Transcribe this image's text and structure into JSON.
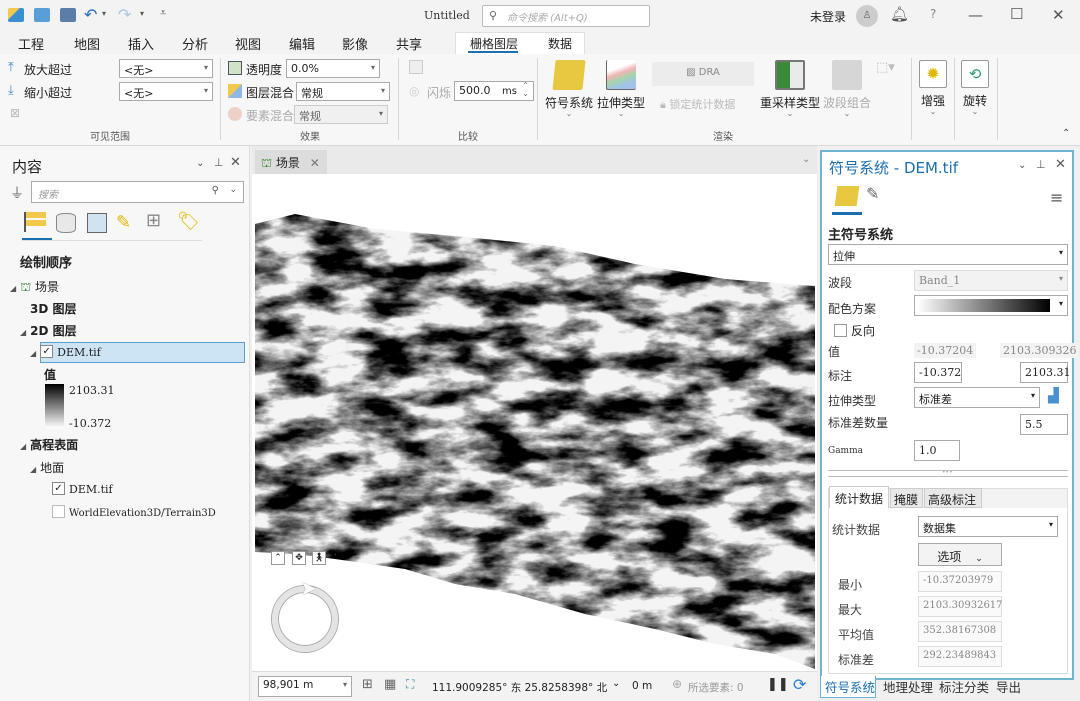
{
  "app": {
    "title": "Untitled",
    "command_search_placeholder": "命令搜索 (Alt+Q)",
    "user_status": "未登录",
    "help": "?",
    "minimize": "—",
    "maximize": "☐",
    "close": "✕"
  },
  "menu_tabs": [
    "工程",
    "地图",
    "插入",
    "分析",
    "视图",
    "编辑",
    "影像",
    "共享"
  ],
  "context_tabs": {
    "raster_layer": "栅格图层",
    "data": "数据",
    "active": "栅格图层"
  },
  "ribbon": {
    "visibility": {
      "zoom_in_beyond": "放大超过",
      "zoom_out_beyond": "缩小超过",
      "zoom_in_value": "<无>",
      "zoom_out_value": "<无>",
      "group_label": "可见范围"
    },
    "effects": {
      "transparency_label": "透明度",
      "transparency_value": "0.0%",
      "layer_blend_label": "图层混合",
      "layer_blend_value": "常规",
      "feature_blend_label": "要素混合",
      "feature_blend_value": "常规",
      "group_label": "效果"
    },
    "compare": {
      "flicker_label": "闪烁",
      "flicker_value": "500.0",
      "flicker_unit": "ms",
      "group_label": "比较"
    },
    "rendering": {
      "symbology": "符号系统",
      "stretch_type": "拉伸类型",
      "dra": "DRA",
      "lock_stats": "锁定统计数据",
      "resample_type": "重采样类型",
      "band_combo": "波段组合",
      "group_label": "渲染"
    },
    "enhance": "增强",
    "rotate": "旋转"
  },
  "contents": {
    "title": "内容",
    "search_placeholder": "搜索",
    "section_title": "绘制顺序",
    "scene": "场景",
    "layers_3d": "3D 图层",
    "layers_2d": "2D 图层",
    "dem_layer": "DEM.tif",
    "dem_checked": true,
    "legend_title": "值",
    "legend_max": "2103.31",
    "legend_min": "-10.372",
    "elevation_surfaces": "高程表面",
    "ground": "地面",
    "ground_sources": [
      {
        "name": "DEM.tif",
        "checked": true
      },
      {
        "name": "WorldElevation3D/Terrain3D",
        "checked": false
      }
    ]
  },
  "map": {
    "tab_label": "场景",
    "scale": "98,901 m",
    "coordinates": "111.9009285° 东 25.8258398° 北",
    "elevation": "0 m",
    "selected_features": "所选要素: 0"
  },
  "symbology": {
    "title": "符号系统 - DEM.tif",
    "primary_section": "主符号系统",
    "renderer": "拉伸",
    "band_label": "波段",
    "band_value": "Band_1",
    "color_scheme_label": "配色方案",
    "invert_label": "反向",
    "invert_checked": false,
    "value_label": "值",
    "value_min": "-10.37204",
    "value_max": "2103.309326",
    "label_label": "标注",
    "label_min": "-10.372",
    "label_max": "2103.31",
    "stretch_type_label": "拉伸类型",
    "stretch_type_value": "标准差",
    "std_dev_count_label": "标准差数量",
    "std_dev_count_value": "5.5",
    "gamma_label": "Gamma",
    "gamma_value": "1.0",
    "subtabs": [
      "统计数据",
      "掩膜",
      "高级标注"
    ],
    "active_subtab": "统计数据",
    "statistics_label": "统计数据",
    "statistics_value": "数据集",
    "options_button": "选项",
    "stats": [
      {
        "label": "最小",
        "value": "-10.37203979"
      },
      {
        "label": "最大",
        "value": "2103.30932617"
      },
      {
        "label": "平均值",
        "value": "352.38167308"
      },
      {
        "label": "标准差",
        "value": "292.23489843"
      }
    ]
  },
  "bottom_tabs": [
    "符号系统",
    "地理处理",
    "标注分类",
    "导出"
  ],
  "colors": {
    "accent": "#1a6fb0",
    "selection": "#cde4f5",
    "panel_border": "#6fb3d6"
  }
}
